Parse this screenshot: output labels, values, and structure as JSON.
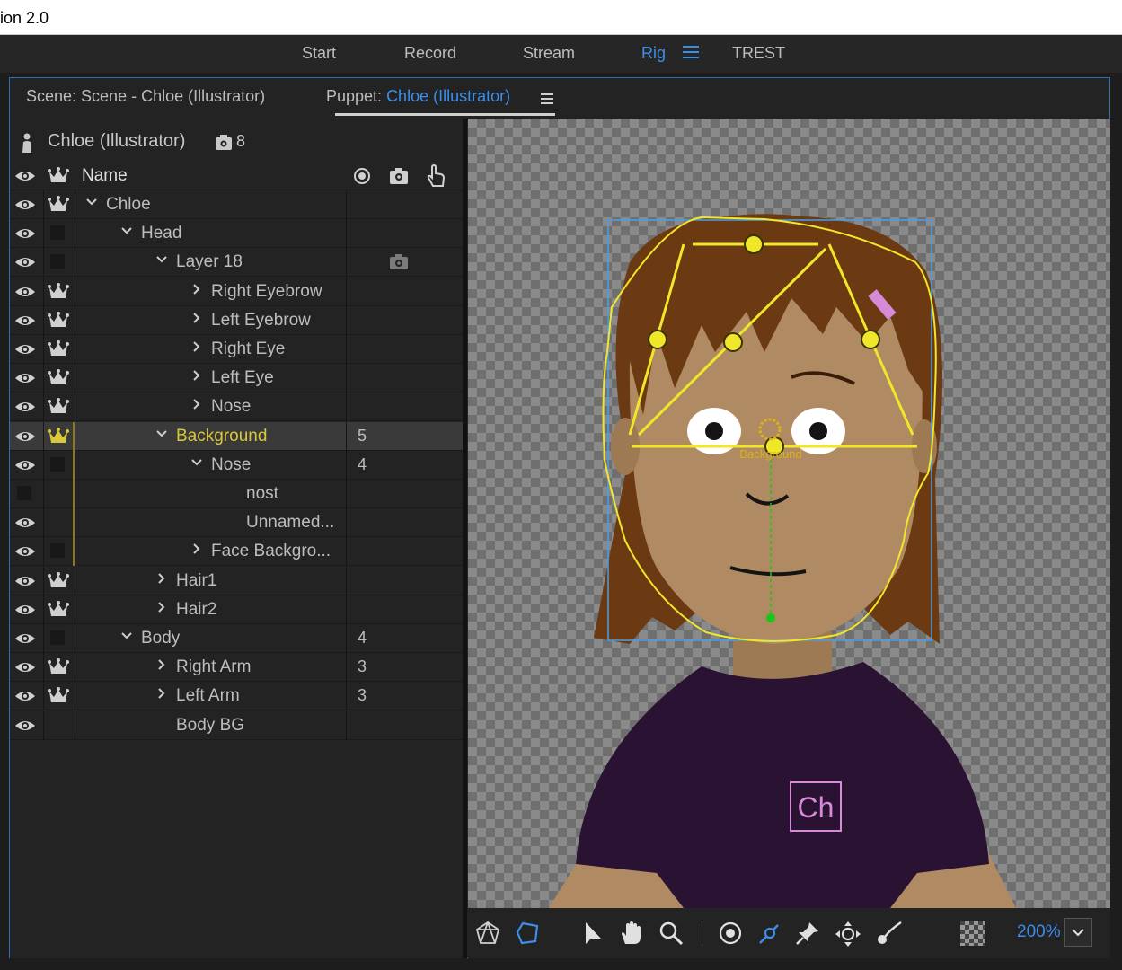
{
  "titlebar": {
    "title": "ion 2.0"
  },
  "workspaces": {
    "items": [
      "Start",
      "Record",
      "Stream",
      "Rig",
      "TREST"
    ],
    "active": "Rig"
  },
  "panel_tabs": {
    "scene_label": "Scene: Scene - Chloe (Illustrator)",
    "puppet_prefix": "Puppet: ",
    "puppet_name": "Chloe (Illustrator)"
  },
  "puppet": {
    "name": "Chloe (Illustrator)",
    "camera_count": "8"
  },
  "columns": {
    "name": "Name"
  },
  "rows": [
    {
      "label": "Chloe",
      "chev": "down",
      "num": ""
    },
    {
      "label": "Head",
      "chev": "down",
      "num": ""
    },
    {
      "label": "Layer 18",
      "chev": "down",
      "num": ""
    },
    {
      "label": "Right Eyebrow",
      "chev": "right",
      "num": ""
    },
    {
      "label": "Left Eyebrow",
      "chev": "right",
      "num": ""
    },
    {
      "label": "Right Eye",
      "chev": "right",
      "num": ""
    },
    {
      "label": "Left Eye",
      "chev": "right",
      "num": ""
    },
    {
      "label": "Nose",
      "chev": "right",
      "num": ""
    },
    {
      "label": "Background",
      "chev": "down",
      "num": "5",
      "selected": true
    },
    {
      "label": "Nose",
      "chev": "down",
      "num": "4"
    },
    {
      "label": "nost",
      "chev": "",
      "num": ""
    },
    {
      "label": "Unnamed...",
      "chev": "",
      "num": ""
    },
    {
      "label": "Face Backgro...",
      "chev": "right",
      "num": ""
    },
    {
      "label": "Hair1",
      "chev": "right",
      "num": ""
    },
    {
      "label": "Hair2",
      "chev": "right",
      "num": ""
    },
    {
      "label": "Body",
      "chev": "down",
      "num": "4"
    },
    {
      "label": "Right Arm",
      "chev": "right",
      "num": "3"
    },
    {
      "label": "Left Arm",
      "chev": "right",
      "num": "3"
    },
    {
      "label": "Body BG",
      "chev": "",
      "num": ""
    }
  ],
  "stage": {
    "handle_label": "Background",
    "shirt_logo": "Ch"
  },
  "toolbar": {
    "zoom": "200%"
  },
  "colors": {
    "accent": "#3d8ee8",
    "selection_gold": "#d9c83a",
    "rig_yellow": "#f0e62a",
    "hair": "#6b3a12",
    "skin": "#b08a62",
    "shirt": "#2a1232"
  }
}
